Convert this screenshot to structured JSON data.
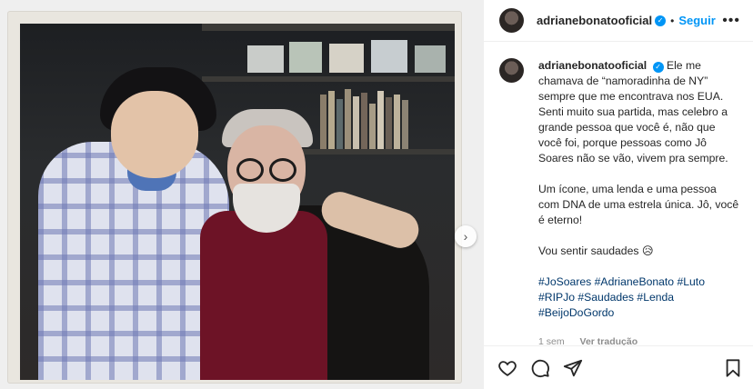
{
  "post": {
    "username": "adrianebonatooficial",
    "follow_label": "Seguir",
    "more_label": "•••",
    "separator": "•",
    "caption": {
      "lines": [
        "Ele me chamava de “namoradinha de NY” sempre que me encontrava nos EUA. Senti muito sua partida, mas celebro a grande pessoa que você é, não que você foi, porque pessoas como Jô Soares não se vão, vivem pra sempre.",
        "Um ícone, uma lenda e uma pessoa com DNA de uma estrela única. Jô, você é eterno!",
        "Vou sentir saudades 😥"
      ],
      "hashtags": [
        "#JoSoares",
        "#AdrianeBonato",
        "#Luto",
        "#RIPJo",
        "#Saudades",
        "#Lenda",
        "#BeijoDoGordo"
      ]
    },
    "time_ago": "1 sem",
    "translate_label": "Ver tradução"
  },
  "icons": {
    "like": "heart-icon",
    "comment": "comment-icon",
    "share": "paper-plane-icon",
    "save": "bookmark-icon",
    "next": "chevron-right-icon",
    "verified": "verified-badge-icon"
  },
  "colors": {
    "accent": "#0095f6",
    "hashtag": "#00376b",
    "muted": "#8e8e8e"
  }
}
